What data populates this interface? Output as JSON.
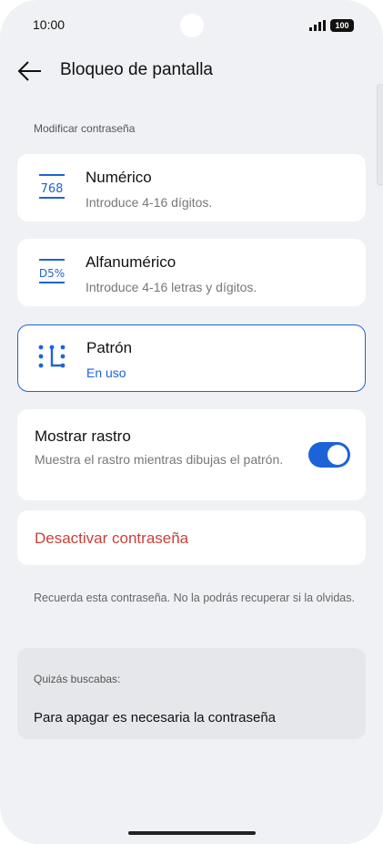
{
  "status": {
    "time": "10:00",
    "battery": "100",
    "signal_icon": "signal-bars-icon"
  },
  "header": {
    "back_icon": "arrow-left-icon",
    "title": "Bloqueo de pantalla"
  },
  "section": {
    "label": "Modificar contraseña"
  },
  "options": [
    {
      "icon": "numeric-keypad-icon",
      "icon_text": "768",
      "title": "Numérico",
      "subtitle": "Introduce 4-16 dígitos."
    },
    {
      "icon": "alphanumeric-icon",
      "icon_text": "D5%",
      "title": "Alfanumérico",
      "subtitle": "Introduce 4-16 letras y dígitos."
    },
    {
      "icon": "pattern-grid-icon",
      "title": "Patrón",
      "subtitle": "En uso",
      "selected": true
    }
  ],
  "show_trail": {
    "title": "Mostrar rastro",
    "description": "Muestra el rastro mientras dibujas el patrón.",
    "enabled": true
  },
  "disable": {
    "label": "Desactivar contraseña"
  },
  "note": "Recuerda esta contraseña. No la podrás recuperar si la olvidas.",
  "suggestions": {
    "label": "Quizás buscabas:",
    "item": "Para apagar es necesaria la contraseña"
  },
  "colors": {
    "accent": "#1d63d8",
    "danger": "#c8413a",
    "background": "#f0f1f5"
  }
}
